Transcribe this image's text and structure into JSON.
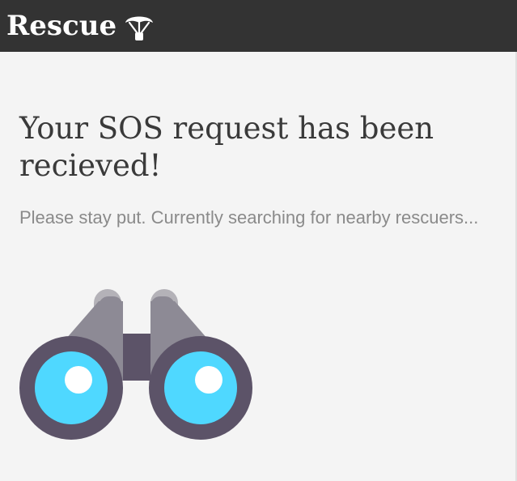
{
  "header": {
    "brand_name": "Rescue",
    "brand_icon": "parachute-icon",
    "bar_color": "#333333"
  },
  "main": {
    "heading": "Your SOS request has been recieved!",
    "status_message": "Please stay put. Currently searching for nearby rescuers...",
    "illustration": "binoculars-icon"
  },
  "colors": {
    "background": "#f4f4f4",
    "heading_text": "#3a3a3a",
    "muted_text": "#8a8a8a",
    "lens": "#4fd8ff",
    "barrel": "#8d8a95",
    "frame": "#5c5368"
  }
}
